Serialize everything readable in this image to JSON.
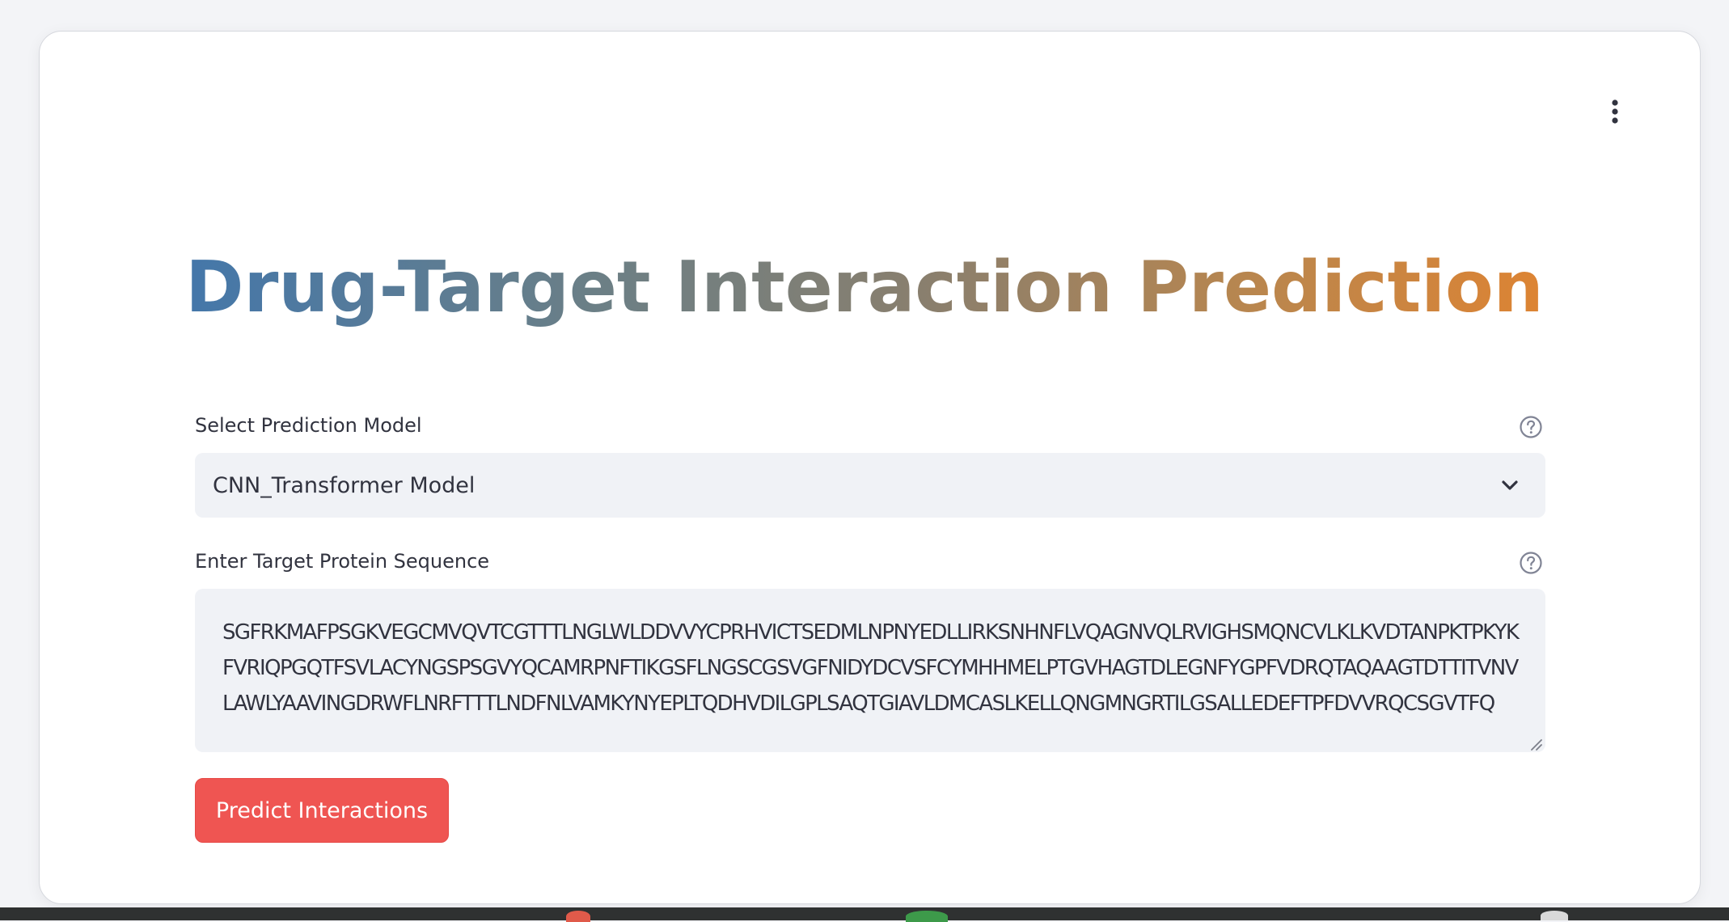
{
  "header": {
    "title": "Drug-Target Interaction Prediction",
    "menu_icon": "kebab-menu-icon"
  },
  "model_select": {
    "label": "Select Prediction Model",
    "value": "CNN_Transformer Model",
    "help_icon": "question-circle-icon",
    "dropdown_icon": "chevron-down-icon"
  },
  "protein_input": {
    "label": "Enter Target Protein Sequence",
    "help_icon": "question-circle-icon",
    "value": "SGFRKMAFPSGKVEGCMVQVTCGTTTLNGLWLDDVVYCPRHVICTSEDMLNPNYEDLLIRKSNHNFLVQAGNVQLRVIGHSMQNCVLKLKVDTANPKTPKYKFVRIQPGQTFSVLACYNGSPSGVYQCAMRPNFTIKGSFLNGSCGSVGFNIDYDCVSFCYMHHMELPTGVHAGTDLEGNFYGPFVDRQTAQAAGTDTTITVNVLAWLYAAVINGDRWFLNRFTTTLNDFNLVAMKYNYEPLTQDHVDILGPLSAQTGIAVLDMCASLKELLQNGMNGRTILGSALLEDEFTPFDVVRQCSGVTFQ"
  },
  "actions": {
    "predict_label": "Predict Interactions"
  },
  "colors": {
    "title_gradient_start": "#4477aa",
    "title_gradient_end": "#dd8433",
    "button_primary": "#ef5552",
    "input_background": "#f0f2f6",
    "text": "#31333f"
  }
}
